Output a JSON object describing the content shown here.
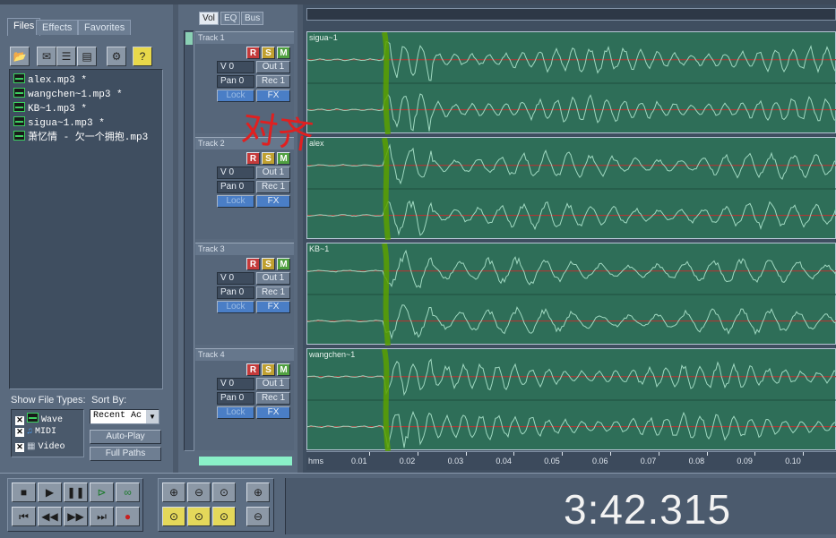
{
  "left_panel": {
    "tabs": [
      "Files",
      "Effects",
      "Favorites"
    ],
    "active_tab": "Files",
    "toolbar_icons": [
      "open-folder-icon",
      "close-file-icon",
      "insert-icon",
      "insert-multitrack-icon",
      "settings-icon",
      "help-icon"
    ],
    "files": [
      "alex.mp3 *",
      "wangchen~1.mp3 *",
      "KB~1.mp3 *",
      "sigua~1.mp3 *",
      "萧忆情 - 欠一个拥抱.mp3"
    ],
    "show_file_types_label": "Show File Types:",
    "file_types": [
      {
        "label": "Wave",
        "checked": true,
        "icon": "wave-type-icon"
      },
      {
        "label": "MIDI",
        "checked": true,
        "icon": "midi-type-icon"
      },
      {
        "label": "Video",
        "checked": true,
        "icon": "video-type-icon"
      }
    ],
    "sort_by_label": "Sort By:",
    "sort_by_value": "Recent Ac",
    "auto_play_label": "Auto-Play",
    "full_paths_label": "Full Paths"
  },
  "track_panel": {
    "tabs": [
      "Vol",
      "EQ",
      "Bus"
    ],
    "active_tab": "Vol",
    "tracks": [
      {
        "label": "Track 1",
        "volume": "V 0",
        "pan": "Pan 0",
        "out": "Out 1",
        "rec": "Rec 1",
        "lock": "Lock",
        "fx": "FX"
      },
      {
        "label": "Track 2",
        "volume": "V 0",
        "pan": "Pan 0",
        "out": "Out 1",
        "rec": "Rec 1",
        "lock": "Lock",
        "fx": "FX"
      },
      {
        "label": "Track 3",
        "volume": "V 0",
        "pan": "Pan 0",
        "out": "Out 1",
        "rec": "Rec 1",
        "lock": "Lock",
        "fx": "FX"
      },
      {
        "label": "Track 4",
        "volume": "V 0",
        "pan": "Pan 0",
        "out": "Out 1",
        "rec": "Rec 1",
        "lock": "Lock",
        "fx": "FX"
      }
    ],
    "rsm": {
      "r": "R",
      "s": "S",
      "m": "M"
    }
  },
  "wave_area": {
    "clips": [
      "sigua~1",
      "alex",
      "KB~1",
      "wangchen~1"
    ],
    "annotation": "对齐",
    "ruler": {
      "unit": "hms",
      "ticks": [
        "0.01",
        "0.02",
        "0.03",
        "0.04",
        "0.05",
        "0.06",
        "0.07",
        "0.08",
        "0.09",
        "0.10"
      ]
    }
  },
  "transport": {
    "time": "3:42.315"
  },
  "colors": {
    "wave_bg": "#2e6e58",
    "wave_line": "#9fd8c0",
    "center_line": "#c03030",
    "cursor_mark": "#5aa000",
    "annotation": "#e02020"
  }
}
